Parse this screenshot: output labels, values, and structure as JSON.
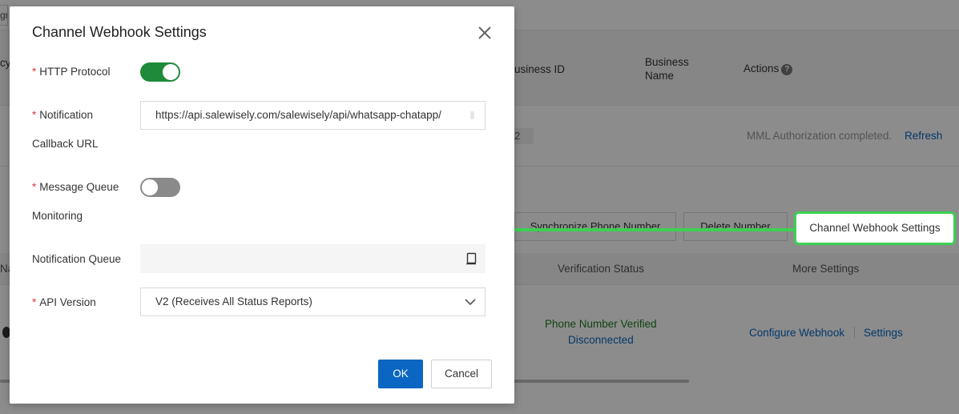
{
  "background": {
    "top_tab_fragment": "gra",
    "header": {
      "left_fragment": "cy",
      "business_id": "usiness ID",
      "business_name_line1": "Business",
      "business_name_line2": "Name",
      "actions": "Actions",
      "help_glyph": "?"
    },
    "row": {
      "value_fragment": "2",
      "status": "MML Authorization completed.",
      "refresh": "Refresh"
    },
    "buttons": {
      "sync": "Synchronize Phone Number",
      "delete": "Delete Number",
      "webhook": "Channel Webhook Settings"
    },
    "sub_header": {
      "name_fragment": "Na",
      "verification_status": "Verification Status",
      "more_settings": "More Settings"
    },
    "entry": {
      "verified": "Phone Number Verified",
      "disconnected": "Disconnected",
      "configure_webhook": "Configure Webhook",
      "settings": "Settings"
    }
  },
  "dialog": {
    "title": "Channel Webhook Settings",
    "http_protocol": {
      "label": "HTTP Protocol",
      "enabled": true
    },
    "notification_callback_url": {
      "label_line1": "Notification",
      "label_line2": "Callback URL",
      "value": "https://api.salewisely.com/salewisely/api/whatsapp-chatapp/"
    },
    "message_queue_monitoring": {
      "label_line1": "Message Queue",
      "label_line2": "Monitoring",
      "enabled": false
    },
    "notification_queue": {
      "label": "Notification Queue",
      "value": ""
    },
    "api_version": {
      "label": "API Version",
      "value": "V2 (Receives All Status Reports)"
    },
    "required_mark": "*",
    "ok": "OK",
    "cancel": "Cancel"
  },
  "colors": {
    "primary": "#0a66c2",
    "toggle_on": "#1f8a3a",
    "toggle_off": "#8a8a8a",
    "required": "#e4393c",
    "highlight_green": "#3bd152",
    "verified_green": "#1f7a1f"
  }
}
